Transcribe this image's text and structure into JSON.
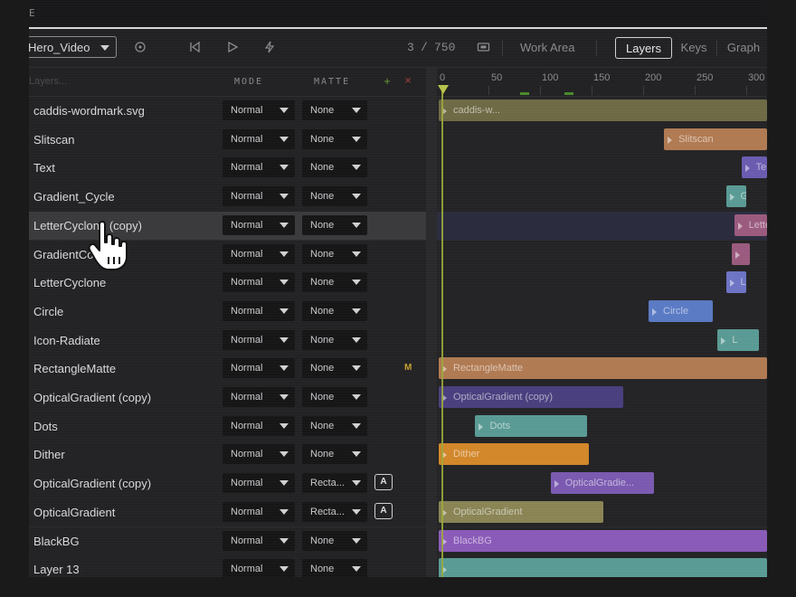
{
  "topstrip": {
    "glyph": "E"
  },
  "toolbar": {
    "composition": "Hero_Video",
    "frame_current": "3",
    "frame_sep": "/",
    "frame_total": "750",
    "work_area_label": "Work Area",
    "tabs": [
      {
        "label": "Layers",
        "active": true
      },
      {
        "label": "Keys",
        "active": false
      },
      {
        "label": "Graph",
        "active": false
      }
    ],
    "icons": [
      "target-icon",
      "skip-start-icon",
      "play-icon",
      "bolt-icon",
      "aspect-icon"
    ]
  },
  "columns": {
    "filter_placeholder": "Layers...",
    "mode": "MODE",
    "matte": "MATTE"
  },
  "ruler": {
    "ticks": [
      "0",
      "50",
      "100",
      "150",
      "200",
      "250",
      "300"
    ]
  },
  "layers": [
    {
      "name": "caddis-wordmark.svg",
      "mode": "Normal",
      "matte": "None",
      "bar": {
        "label": "caddis-w...",
        "color": "#6e6a45",
        "start": 0,
        "end": 330
      }
    },
    {
      "name": "Slitscan",
      "mode": "Normal",
      "matte": "None",
      "bar": {
        "label": "Slitscan",
        "color": "#b07a52",
        "start": 215,
        "end": 330
      }
    },
    {
      "name": "Text",
      "mode": "Normal",
      "matte": "None",
      "bar": {
        "label": "Te",
        "color": "#6b5bb0",
        "start": 290,
        "end": 330
      }
    },
    {
      "name": "Gradient_Cycle",
      "mode": "Normal",
      "matte": "None",
      "bar": {
        "label": "G",
        "color": "#5a9a94",
        "start": 275,
        "end": 295
      }
    },
    {
      "name": "LetterCyclone (copy)",
      "mode": "Normal",
      "matte": "None",
      "selected": true,
      "bar": {
        "label": "Lette",
        "color": "#9a5a7e",
        "start": 283,
        "end": 330
      }
    },
    {
      "name": "GradientColours",
      "mode": "Normal",
      "matte": "None",
      "bar": {
        "label": "",
        "color": "#9a5a7e",
        "start": 281,
        "end": 298
      }
    },
    {
      "name": "LetterCyclone",
      "mode": "Normal",
      "matte": "None",
      "bar": {
        "label": "Le",
        "color": "#6d74c4",
        "start": 275,
        "end": 295
      }
    },
    {
      "name": "Circle",
      "mode": "Normal",
      "matte": "None",
      "bar": {
        "label": "Circle",
        "color": "#5a7ac4",
        "start": 200,
        "end": 262
      }
    },
    {
      "name": "Icon-Radiate",
      "mode": "Normal",
      "matte": "None",
      "bar": {
        "label": "L",
        "color": "#5a9a94",
        "start": 267,
        "end": 307
      }
    },
    {
      "name": "RectangleMatte",
      "mode": "Normal",
      "matte": "None",
      "matte_badge": "M",
      "bar": {
        "label": "RectangleMatte",
        "color": "#b07a52",
        "start": 0,
        "end": 330
      }
    },
    {
      "name": "OpticalGradient (copy)",
      "mode": "Normal",
      "matte": "None",
      "bar": {
        "label": "OpticalGradient (copy)",
        "color": "#4a3f7e",
        "start": 0,
        "end": 175
      }
    },
    {
      "name": "Dots",
      "mode": "Normal",
      "matte": "None",
      "bar": {
        "label": "Dots",
        "color": "#5a9a94",
        "start": 32,
        "end": 140
      }
    },
    {
      "name": "Dither",
      "mode": "Normal",
      "matte": "None",
      "bar": {
        "label": "Dither",
        "color": "#d2872a",
        "start": 0,
        "end": 142
      }
    },
    {
      "name": "OpticalGradient (copy)",
      "mode": "Normal",
      "matte": "Recta...",
      "matte_badge_box": "A",
      "bar": {
        "label": "OpticalGradie...",
        "color": "#7a5ab0",
        "start": 105,
        "end": 205
      }
    },
    {
      "name": "OpticalGradient",
      "mode": "Normal",
      "matte": "Recta...",
      "matte_badge_box": "A",
      "bar": {
        "label": "OpticalGradient",
        "color": "#8a8455",
        "start": 0,
        "end": 156
      }
    },
    {
      "name": "BlackBG",
      "mode": "Normal",
      "matte": "None",
      "bar": {
        "label": "BlackBG",
        "color": "#8a5ab8",
        "start": 0,
        "end": 330
      }
    },
    {
      "name": "Layer 13",
      "mode": "Normal",
      "matte": "None",
      "bar": {
        "label": "",
        "color": "#5a9a94",
        "start": 0,
        "end": 330
      }
    }
  ],
  "colors": {
    "accent_playhead": "#b8c44a",
    "add": "#6a9a3a",
    "remove": "#a03a3a",
    "matte_badge": "#c8a030"
  }
}
